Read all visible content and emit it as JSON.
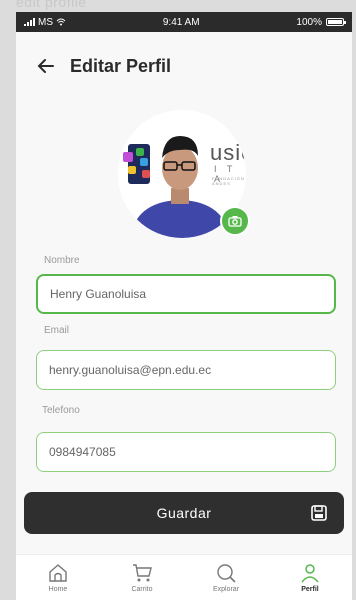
{
  "frame_label": "edit profile",
  "status": {
    "carrier": "MS",
    "time": "9:41 AM",
    "battery": "100%"
  },
  "header": {
    "title": "Editar Perfil"
  },
  "avatar": {
    "logo_text": "usió",
    "logo_sub": "I T A",
    "logo_mini": "FUNDACIÓN ANDES"
  },
  "form": {
    "name_label": "Nombre",
    "name_value": "Henry Guanoluisa",
    "email_label": "Email",
    "email_value": "henry.guanoluisa@epn.edu.ec",
    "phone_label": "Telefono",
    "phone_value": "0984947085"
  },
  "save_label": "Guardar",
  "nav": [
    {
      "label": "Home",
      "icon": "home-icon"
    },
    {
      "label": "Carrito",
      "icon": "cart-icon"
    },
    {
      "label": "Explorar",
      "icon": "search-icon"
    },
    {
      "label": "Perfil",
      "icon": "user-icon"
    }
  ],
  "colors": {
    "accent": "#56b84a",
    "dark": "#2f2f2f"
  }
}
